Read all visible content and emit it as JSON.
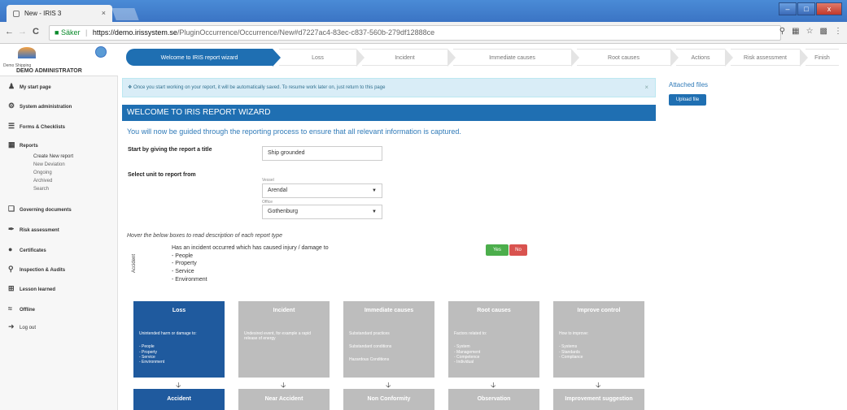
{
  "browser": {
    "tab_title": "New - IRIS 3",
    "tab_close": "×",
    "secure_label": "Säker",
    "url_host": "https://demo.irissystem.se",
    "url_path": "/PluginOccurrence/Occurrence/New#d7227ac4-83ec-c837-560b-279df12888ce",
    "back": "←",
    "forward": "→",
    "reload": "C",
    "minimize": "–",
    "maximize": "□",
    "close": "x"
  },
  "sidebar": {
    "company": "Demo Shipping",
    "admin": "DEMO ADMINISTRATOR",
    "items": [
      {
        "label": "My start page",
        "icon": "user-icon"
      },
      {
        "label": "System administration",
        "icon": "gear-icon"
      },
      {
        "label": "Forms & Checklists",
        "icon": "list-icon"
      },
      {
        "label": "Reports",
        "icon": "report-icon"
      },
      {
        "label": "Governing documents",
        "icon": "documents-icon"
      },
      {
        "label": "Risk assessment",
        "icon": "pen-icon"
      },
      {
        "label": "Certificates",
        "icon": "certificate-icon"
      },
      {
        "label": "Inspection & Audits",
        "icon": "search-icon"
      },
      {
        "label": "Lesson learned",
        "icon": "lesson-icon"
      },
      {
        "label": "Offline",
        "icon": "wifi-icon"
      },
      {
        "label": "Log out",
        "icon": "logout-icon"
      }
    ],
    "report_sub": [
      "Create New report",
      "New Deviation",
      "Ongoing",
      "Archived",
      "Search"
    ]
  },
  "stepper": [
    "Welcome to IRIS report wizard",
    "Loss",
    "Incident",
    "Immediate causes",
    "Root causes",
    "Actions",
    "Risk assessment",
    "Finish"
  ],
  "info": {
    "text": "Once you start working on your report, it will be automatically saved. To resume work later on, just return to this page",
    "close": "×"
  },
  "wizard": {
    "heading": "WELCOME TO IRIS REPORT WIZARD",
    "intro": "You will now be guided through the reporting process to ensure that all relevant information is captured.",
    "title_label": "Start by giving the report a title",
    "title_value": "Ship grounded",
    "unit_label": "Select unit to report from",
    "vessel_label": "Vessel",
    "vessel_value": "Arendal",
    "office_label": "Office",
    "office_value": "Gothenburg",
    "hover_note": "Hover the below boxes to read description of each report type",
    "type_name": "Accident",
    "desc_lines": [
      "Has an incident occurred which has caused injury / damage to",
      "- People",
      "- Property",
      "- Service",
      "- Environment"
    ],
    "yes": "Yes",
    "no": "No"
  },
  "cards": [
    {
      "title": "Loss",
      "lines": [
        "Unintended harm or damage to:",
        "",
        "- People",
        "- Property",
        "- Service",
        "- Environment"
      ],
      "bottom": "Accident"
    },
    {
      "title": "Incident",
      "lines": [
        "Undesired event, for example a rapid release of energy"
      ],
      "bottom": "Near Accident"
    },
    {
      "title": "Immediate causes",
      "lines": [
        "Substandard practices",
        "",
        "Substandard conditions",
        "",
        "Hazardous Conditions"
      ],
      "bottom": "Non Conformity"
    },
    {
      "title": "Root causes",
      "lines": [
        "Factors related to:",
        "",
        "- System",
        "- Management",
        "- Competence",
        "- Individual"
      ],
      "bottom": "Observation"
    },
    {
      "title": "Improve control",
      "lines": [
        "How to improve:",
        "",
        "- Systems",
        "- Standards",
        "- Compliance"
      ],
      "bottom": "Improvement suggestion"
    }
  ],
  "right": {
    "attached": "Attached files",
    "upload": "Upload file"
  }
}
